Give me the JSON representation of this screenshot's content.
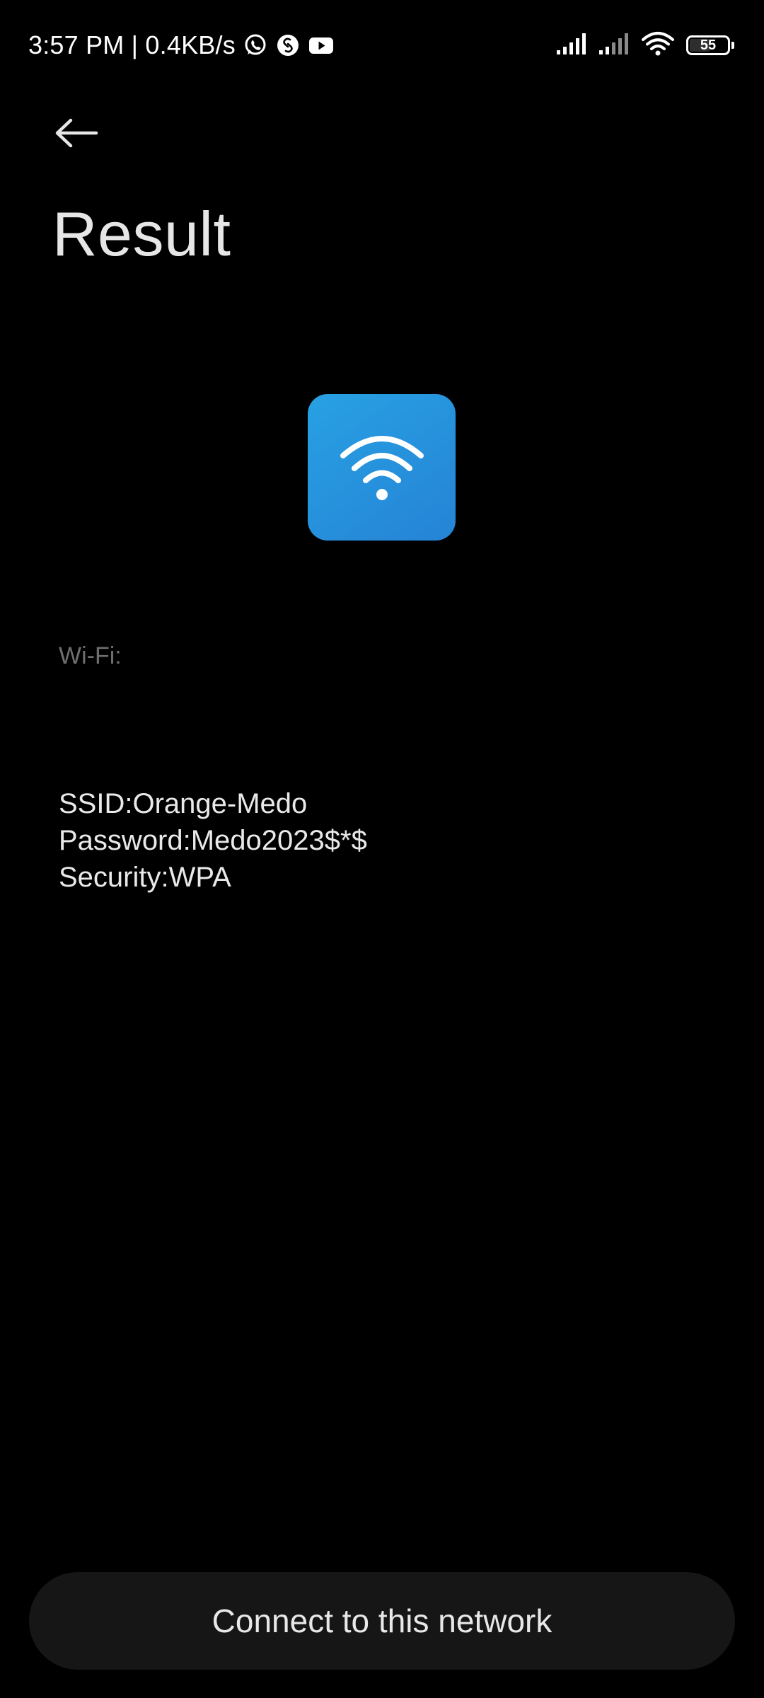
{
  "status_bar": {
    "time_and_speed": "3:57 PM | 0.4KB/s",
    "app_icons": [
      "whatsapp-icon",
      "shazam-icon",
      "youtube-icon"
    ],
    "battery_level": "55",
    "battery_fraction": 0.55
  },
  "header": {
    "back_icon": "back-arrow-icon",
    "title": "Result"
  },
  "result": {
    "icon": "wifi-icon",
    "icon_color": "#2894dd",
    "type_label": "Wi-Fi:",
    "ssid": "SSID:Orange-Medo",
    "password": "Password:Medo2023$*$",
    "security": "Security:WPA"
  },
  "actions": {
    "connect_label": "Connect to this network"
  }
}
